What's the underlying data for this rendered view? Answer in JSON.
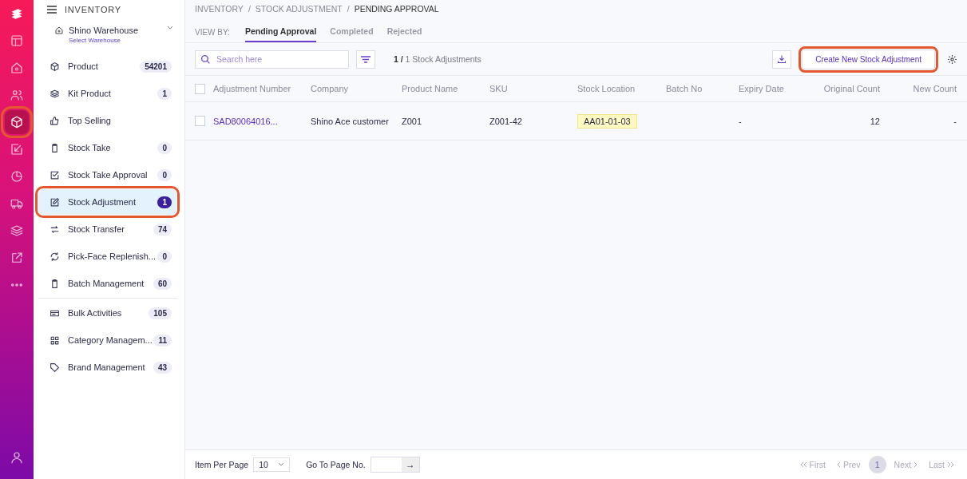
{
  "rail": [
    {
      "selected": false,
      "highlighted": false
    },
    {
      "selected": false,
      "highlighted": false
    },
    {
      "selected": false,
      "highlighted": false
    },
    {
      "selected": true,
      "highlighted": true
    },
    {
      "selected": false,
      "highlighted": false
    },
    {
      "selected": false,
      "highlighted": false
    },
    {
      "selected": false,
      "highlighted": false
    },
    {
      "selected": false,
      "highlighted": false
    },
    {
      "selected": false,
      "highlighted": false
    },
    {
      "selected": false,
      "highlighted": false
    },
    {
      "selected": false,
      "highlighted": false
    }
  ],
  "sidebar": {
    "title": "INVENTORY",
    "warehouse": {
      "name": "Shino Warehouse",
      "hint": "Select Warehouse"
    },
    "groups": [
      [
        {
          "label": "Product",
          "count": "54201",
          "selected": false,
          "highlighted": false
        },
        {
          "label": "Kit Product",
          "count": "1",
          "selected": false,
          "highlighted": false
        },
        {
          "label": "Top Selling",
          "selected": false,
          "highlighted": false
        },
        {
          "label": "Stock Take",
          "count": "0",
          "selected": false,
          "highlighted": false
        },
        {
          "label": "Stock Take Approval",
          "count": "0",
          "selected": false,
          "highlighted": false
        },
        {
          "label": "Stock Adjustment",
          "count": "1",
          "selected": true,
          "highlighted": true
        },
        {
          "label": "Stock Transfer",
          "count": "74",
          "selected": false,
          "highlighted": false
        },
        {
          "label": "Pick-Face Replenish...",
          "count": "0",
          "selected": false,
          "highlighted": false
        },
        {
          "label": "Batch Management",
          "count": "60",
          "selected": false,
          "highlighted": false
        }
      ],
      [
        {
          "label": "Bulk Activities",
          "count": "105",
          "selected": false,
          "highlighted": false
        },
        {
          "label": "Category Managem...",
          "count": "11",
          "selected": false,
          "highlighted": false
        },
        {
          "label": "Brand Management",
          "count": "43",
          "selected": false,
          "highlighted": false
        }
      ]
    ]
  },
  "breadcrumb": [
    {
      "kind": "link",
      "text": "INVENTORY"
    },
    {
      "kind": "separator",
      "text": "/"
    },
    {
      "kind": "link",
      "text": "STOCK ADJUSTMENT"
    },
    {
      "kind": "separator",
      "text": "/"
    },
    {
      "kind": "current",
      "text": "PENDING APPROVAL"
    }
  ],
  "view_by": {
    "label": "VIEW BY:",
    "tabs": [
      {
        "label": "Pending Approval",
        "selected": true
      },
      {
        "label": "Completed",
        "selected": false
      },
      {
        "label": "Rejected",
        "selected": false
      }
    ]
  },
  "search": {
    "placeholder": "Search here"
  },
  "result_count": {
    "shown": "1 /",
    "rest": "1 Stock Adjustments"
  },
  "create_button": {
    "label": "Create New Stock Adjustment",
    "highlighted": true
  },
  "table": {
    "all_checked": false,
    "columns": [
      "Adjustment Number",
      "Company",
      "Product Name",
      "SKU",
      "Stock Location",
      "Batch No",
      "Expiry Date",
      "Original Count",
      "New Count"
    ],
    "rows": [
      {
        "checked": false,
        "cells": [
          "SAD80064016...",
          "Shino Ace customer",
          "Z001",
          "Z001-42",
          "AA01-01-03",
          "",
          "-",
          "12",
          "-"
        ]
      }
    ]
  },
  "footer": {
    "per_page_label": "Item Per Page",
    "per_page": "10",
    "goto_label": "Go To Page No.",
    "go": "→",
    "first": "First",
    "prev": "Prev",
    "page": "1",
    "next": "Next",
    "last": "Last"
  }
}
